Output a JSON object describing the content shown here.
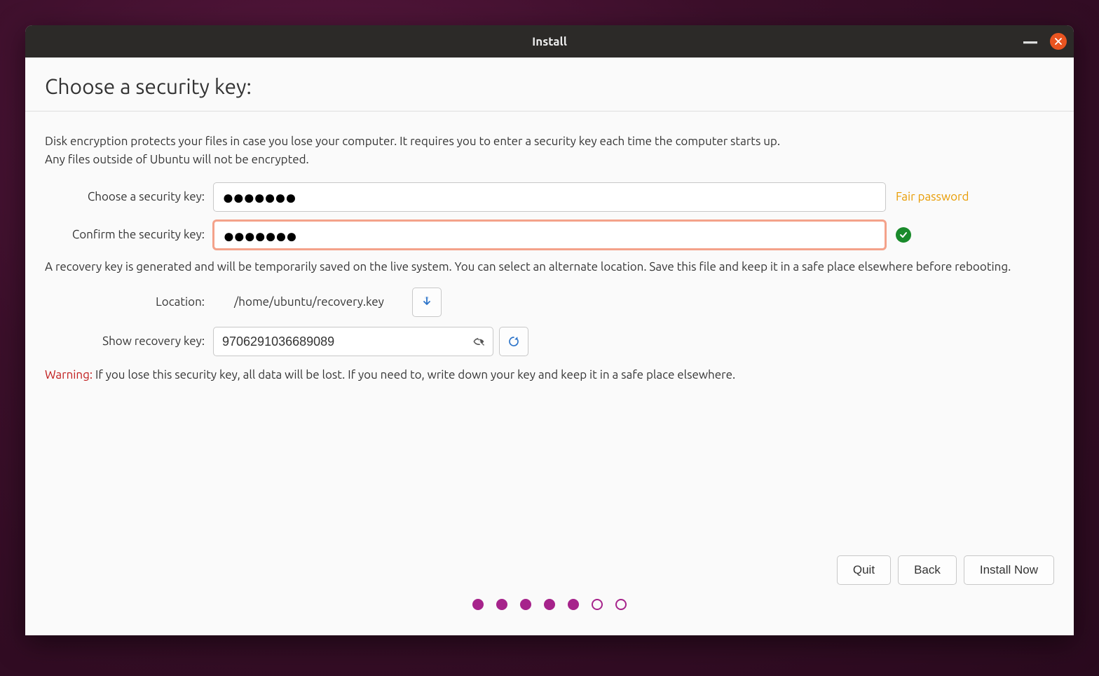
{
  "window": {
    "title": "Install"
  },
  "page": {
    "heading": "Choose a security key:",
    "description1": "Disk encryption protects your files in case you lose your computer. It requires you to enter a security key each time the computer starts up.",
    "description2": "Any files outside of Ubuntu will not be encrypted."
  },
  "fields": {
    "choose_label": "Choose a security key:",
    "choose_value": "●●●●●●●",
    "confirm_label": "Confirm the security key:",
    "confirm_value": "●●●●●●●",
    "strength": "Fair password",
    "location_label": "Location:",
    "location_value": "/home/ubuntu/recovery.key",
    "show_recovery_label": "Show recovery key:",
    "recovery_value": "9706291036689089"
  },
  "recovery_desc": "A recovery key is generated and will be temporarily saved on the live system. You can select an alternate location. Save this file and keep it in a safe place elsewhere before rebooting.",
  "warning": {
    "label": "Warning:",
    "text": " If you lose this security key, all data will be lost. If you need to, write down your key and keep it in a safe place elsewhere."
  },
  "buttons": {
    "quit": "Quit",
    "back": "Back",
    "install": "Install Now"
  },
  "progress": {
    "total": 7,
    "filled": 5
  }
}
